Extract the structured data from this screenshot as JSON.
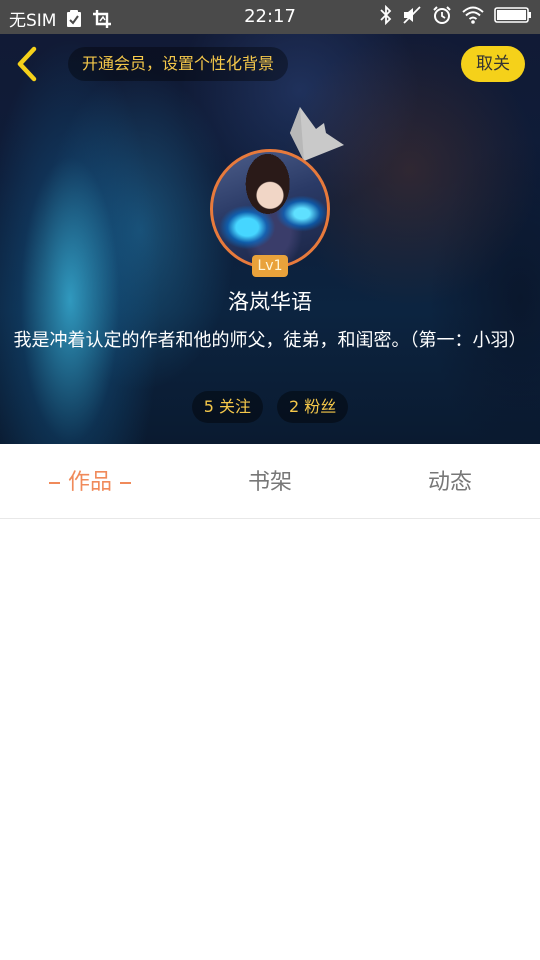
{
  "status_bar": {
    "carrier": "无SIM",
    "time": "22:17"
  },
  "header": {
    "vip_banner": "开通会员，设置个性化背景",
    "unfollow_label": "取关"
  },
  "profile": {
    "level": "Lv1",
    "username": "洛岚华语",
    "bio": "我是冲着认定的作者和他的师父，徒弟，和闺密。（第一：小羽）",
    "following": "5 关注",
    "followers": "2 粉丝"
  },
  "tabs": [
    {
      "label": "作品",
      "active": true
    },
    {
      "label": "书架",
      "active": false
    },
    {
      "label": "动态",
      "active": false
    }
  ],
  "colors": {
    "accent": "#f08a5a",
    "gold": "#f5c84a",
    "button_yellow": "#f5d11a",
    "avatar_ring": "#e77a3c",
    "status_bar": "#4a4a4a"
  }
}
